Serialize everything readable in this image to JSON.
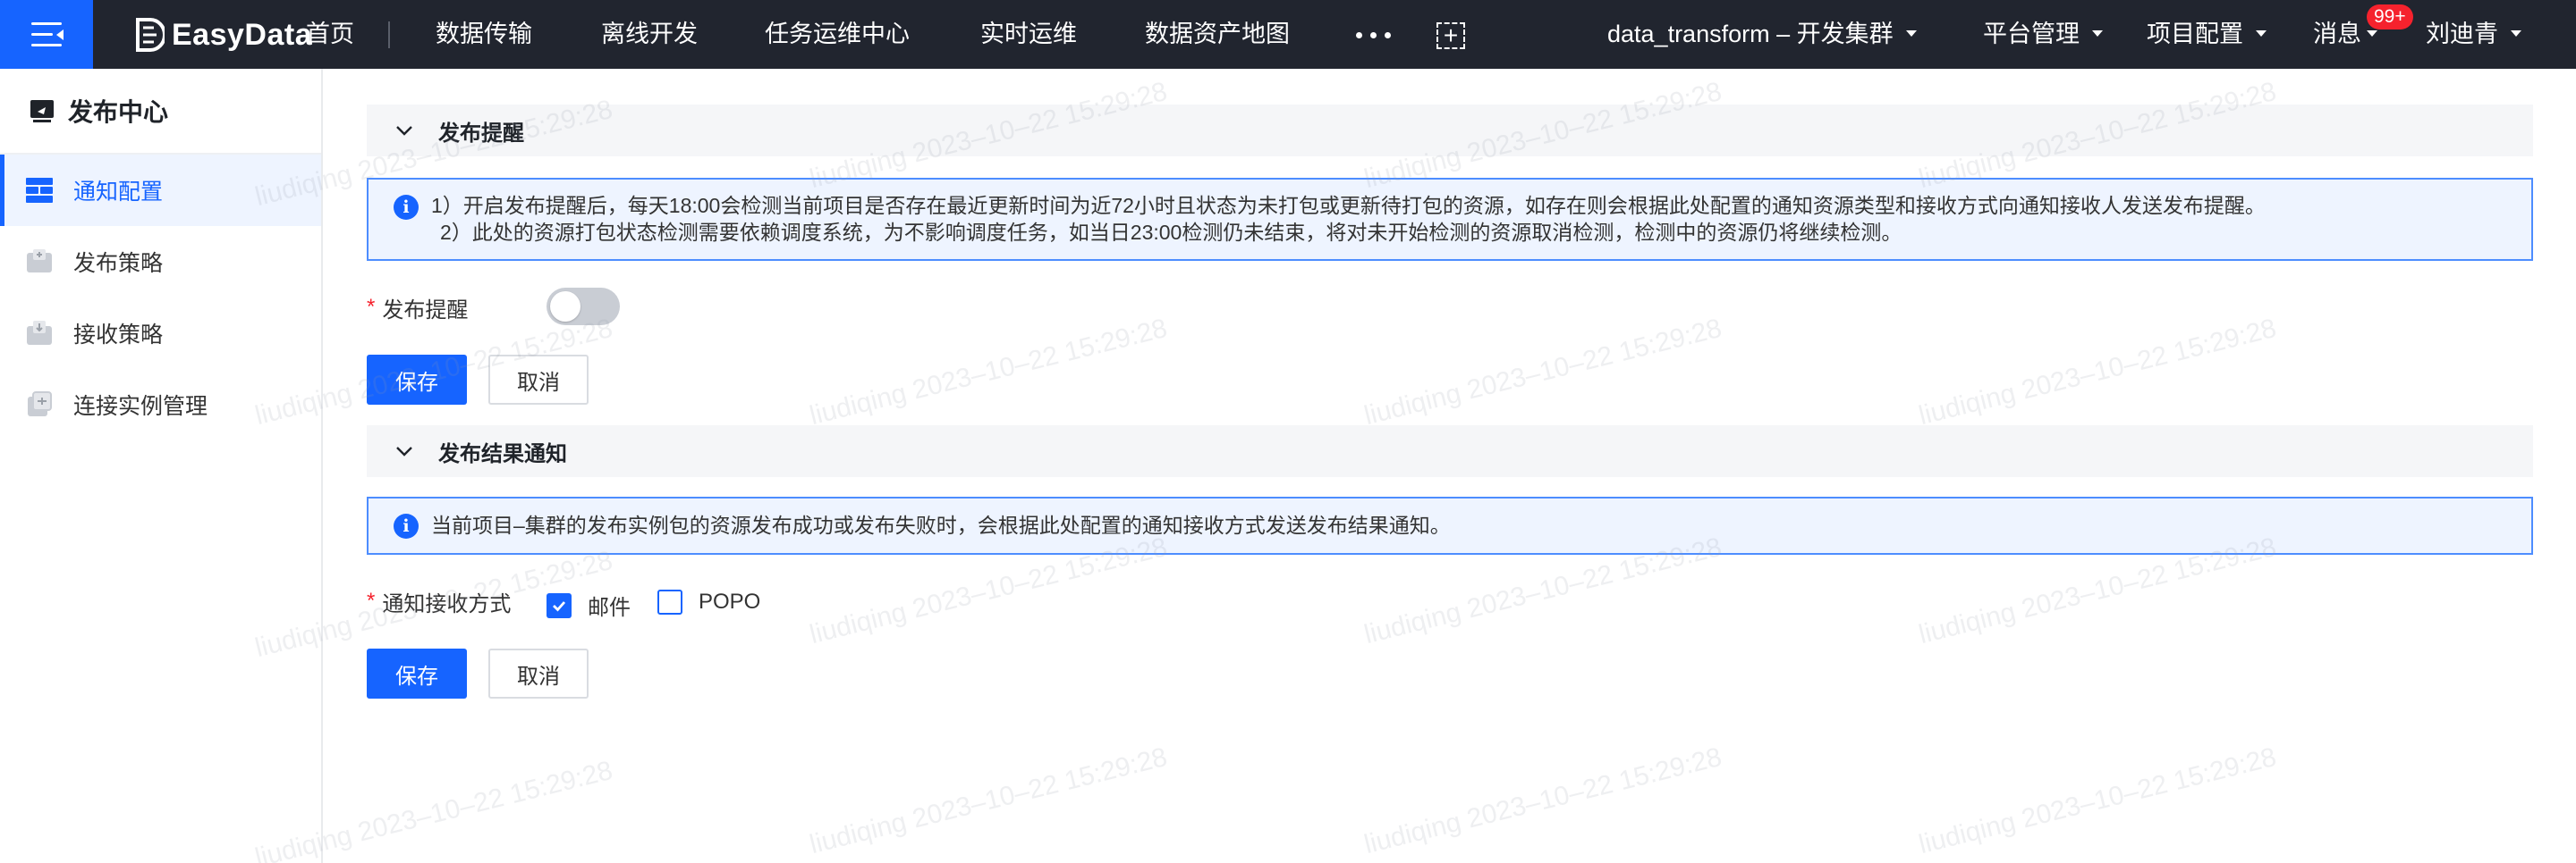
{
  "topbar": {
    "brand": "EasyData",
    "nav": [
      "首页",
      "数据传输",
      "离线开发",
      "任务运维中心",
      "实时运维",
      "数据资产地图"
    ],
    "project_selector": "data_transform – 开发集群",
    "platform_menu": "平台管理",
    "project_config_menu": "项目配置",
    "messages": "消息",
    "messages_badge": "99+",
    "user": "刘迪青"
  },
  "sidebar": {
    "title": "发布中心",
    "items": [
      {
        "label": "通知配置",
        "icon": "notification-config-icon",
        "active": true
      },
      {
        "label": "发布策略",
        "icon": "publish-strategy-icon",
        "active": false
      },
      {
        "label": "接收策略",
        "icon": "receive-strategy-icon",
        "active": false
      },
      {
        "label": "连接实例管理",
        "icon": "connection-instance-icon",
        "active": false
      }
    ]
  },
  "release_reminder": {
    "section_title": "发布提醒",
    "info_lines": [
      "1）开启发布提醒后，每天18:00会检测当前项目是否存在最近更新时间为近72小时且状态为未打包或更新待打包的资源，如存在则会根据此处配置的通知资源类型和接收方式向通知接收人发送发布提醒。",
      "2）此处的资源打包状态检测需要依赖调度系统，为不影响调度任务，如当日23:00检测仍未结束，将对未开始检测的资源取消检测，检测中的资源仍将继续检测。"
    ],
    "toggle_label": "发布提醒",
    "toggle_on": false,
    "save_label": "保存",
    "cancel_label": "取消"
  },
  "result_notice": {
    "section_title": "发布结果通知",
    "info_text": "当前项目–集群的发布实例包的资源发布成功或发布失败时，会根据此处配置的通知接收方式发送发布结果通知。",
    "method_label": "通知接收方式",
    "options": [
      {
        "label": "邮件",
        "checked": true
      },
      {
        "label": "POPO",
        "checked": false
      }
    ],
    "save_label": "保存",
    "cancel_label": "取消"
  },
  "watermark": "liudiqing 2023–10–22 15:29:28",
  "colors": {
    "primary": "#1664ff",
    "topbar": "#21252f",
    "info_bg": "#eef4ff",
    "required": "#f5222d"
  }
}
